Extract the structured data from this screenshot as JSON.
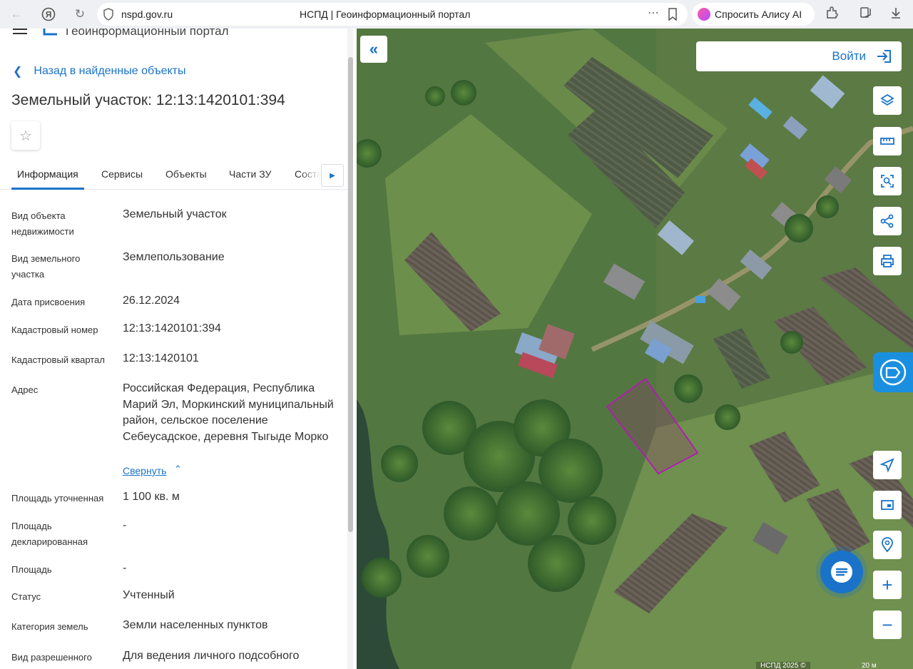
{
  "browser": {
    "domain": "nspd.gov.ru",
    "tab_title": "НСПД | Геоинформационный портал",
    "alisa_label": "Спросить Алису AI"
  },
  "header": {
    "portal_name": "Геоинформационный портал"
  },
  "panel": {
    "back_label": "Назад в найденные объекты",
    "title": "Земельный участок: 12:13:1420101:394",
    "tabs": [
      {
        "label": "Информация",
        "active": true
      },
      {
        "label": "Сервисы"
      },
      {
        "label": "Объекты"
      },
      {
        "label": "Части ЗУ"
      },
      {
        "label": "Соста"
      }
    ],
    "properties": [
      {
        "label": "Вид объекта недвижимости",
        "value": "Земельный участок"
      },
      {
        "label": "Вид земельного участка",
        "value": "Землепользование"
      },
      {
        "label": "Дата присвоения",
        "value": "26.12.2024"
      },
      {
        "label": "Кадастровый номер",
        "value": "12:13:1420101:394"
      },
      {
        "label": "Кадастровый квартал",
        "value": "12:13:1420101"
      },
      {
        "label": "Адрес",
        "value": "Российская Федерация, Республика Марий Эл, Моркинский муниципальный район, сельское поселение Себеусадское, деревня Тыгыде Морко"
      },
      {
        "label": "Площадь уточненная",
        "value": "1 100 кв. м"
      },
      {
        "label": "Площадь декларированная",
        "value": "-"
      },
      {
        "label": "Площадь",
        "value": "-"
      },
      {
        "label": "Статус",
        "value": "Учтенный"
      },
      {
        "label": "Категория земель",
        "value": "Земли населенных пунктов"
      },
      {
        "label": "Вид разрешенного",
        "value": "Для ведения личного подсобного"
      }
    ],
    "collapse_label": "Свернуть"
  },
  "map": {
    "login_label": "Войти",
    "footer": "НСПД 2025 ©",
    "scale": "20 м",
    "parcel_color": "#b01fb0",
    "accent": "#1a73c9"
  }
}
